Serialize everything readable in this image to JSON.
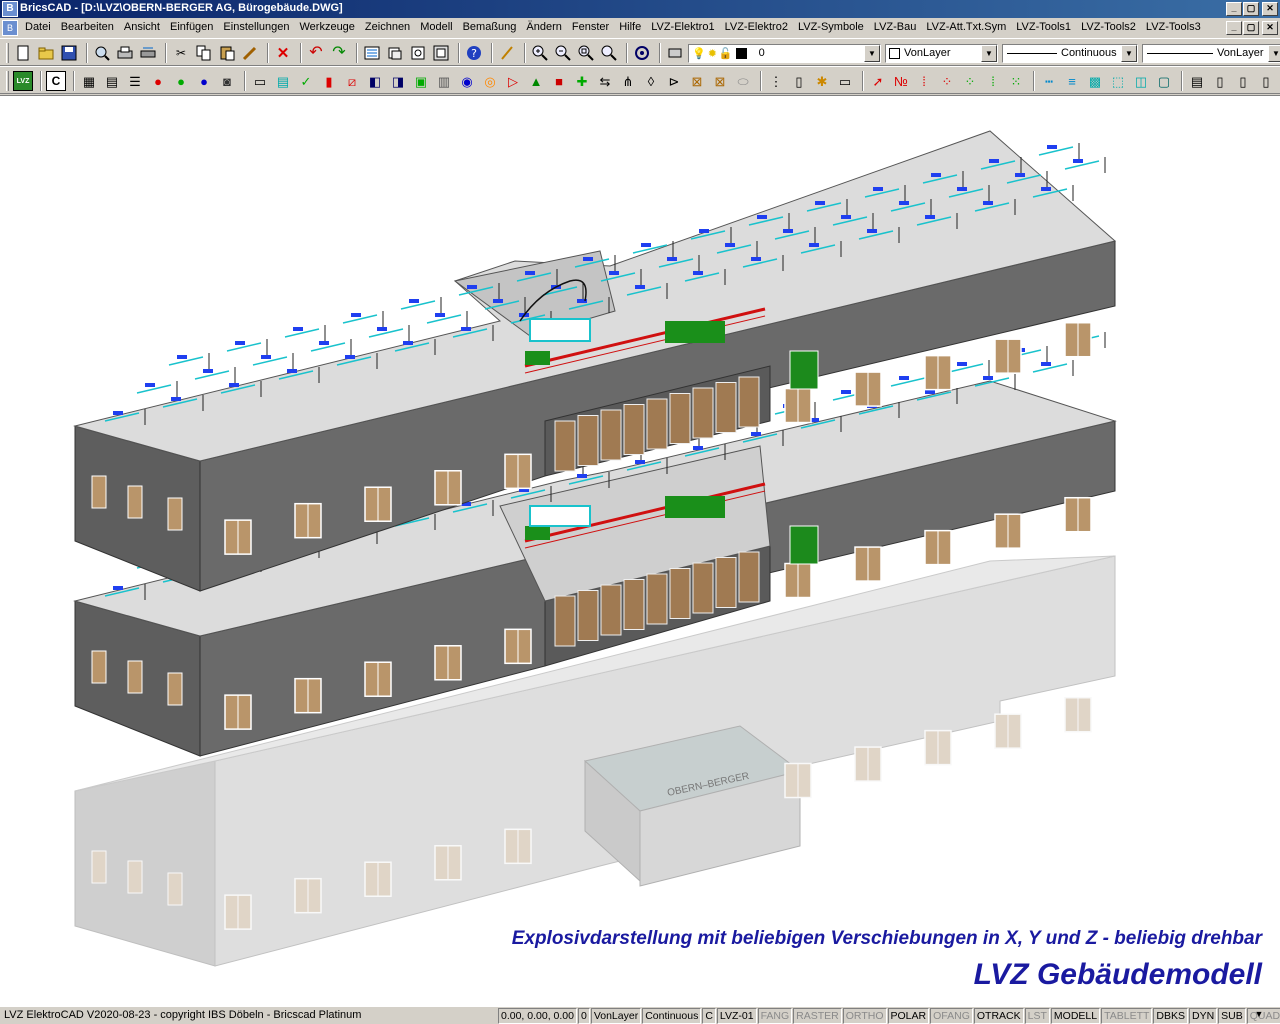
{
  "window": {
    "title": "BricsCAD - [D:\\LVZ\\OBERN-BERGER AG, Bürogebäude.DWG]",
    "app_icon": "bricscad-icon",
    "buttons": [
      "_",
      "▢",
      "✕"
    ]
  },
  "menubar": {
    "items": [
      "Datei",
      "Bearbeiten",
      "Ansicht",
      "Einfügen",
      "Einstellungen",
      "Werkzeuge",
      "Zeichnen",
      "Modell",
      "Bemaßung",
      "Ändern",
      "Fenster",
      "Hilfe",
      "LVZ-Elektro1",
      "LVZ-Elektro2",
      "LVZ-Symbole",
      "LVZ-Bau",
      "LVZ-Att.Txt.Sym",
      "LVZ-Tools1",
      "LVZ-Tools2",
      "LVZ-Tools3"
    ]
  },
  "toolbar1": {
    "icons": [
      "new-icon",
      "open-icon",
      "save-icon",
      "preview-icon",
      "print-icon",
      "plot-icon",
      "cut-icon",
      "copy-icon",
      "paste-icon",
      "match-icon",
      "delete-icon",
      "undo-icon",
      "redo-icon",
      "properties-icon",
      "explorer-icon",
      "library-icon",
      "tool-palette-icon",
      "help-icon",
      "pen-icon",
      "zoom-in-icon",
      "zoom-out-icon",
      "zoom-window-icon",
      "zoom-realtime-icon",
      "orbit-icon",
      "layer-states-icon"
    ],
    "layer_value": "0",
    "color_value": "VonLayer",
    "linetype_value": "Continuous",
    "lineweight_value": "VonLayer"
  },
  "toolbar2": {
    "first_label": "LVZ",
    "second_label": "C"
  },
  "canvas": {
    "caption": "Explosivdarstellung mit beliebigen Verschiebungen in X, Y und Z - beliebig drehbar",
    "brand": "LVZ Gebäudemodell",
    "sign_text": "OBERN–BERGER"
  },
  "statusbar": {
    "text": "LVZ ElektroCAD V2020-08-23 - copyright IBS Döbeln - Bricscad Platinum",
    "fields": [
      {
        "label": "0.00, 0.00, 0.00",
        "on": true
      },
      {
        "label": "0",
        "on": true
      },
      {
        "label": "VonLayer",
        "on": true
      },
      {
        "label": "Continuous",
        "on": true
      },
      {
        "label": "C",
        "on": true
      },
      {
        "label": "LVZ-01",
        "on": true
      },
      {
        "label": "FANG",
        "on": false
      },
      {
        "label": "RASTER",
        "on": false
      },
      {
        "label": "ORTHO",
        "on": false
      },
      {
        "label": "POLAR",
        "on": true
      },
      {
        "label": "OFANG",
        "on": false
      },
      {
        "label": "OTRACK",
        "on": true
      },
      {
        "label": "LST",
        "on": false
      },
      {
        "label": "MODELL",
        "on": true
      },
      {
        "label": "TABLETT",
        "on": false
      },
      {
        "label": "DBKS",
        "on": true
      },
      {
        "label": "DYN",
        "on": true
      },
      {
        "label": "SUB",
        "on": true
      },
      {
        "label": "QUAD",
        "on": false
      }
    ]
  }
}
